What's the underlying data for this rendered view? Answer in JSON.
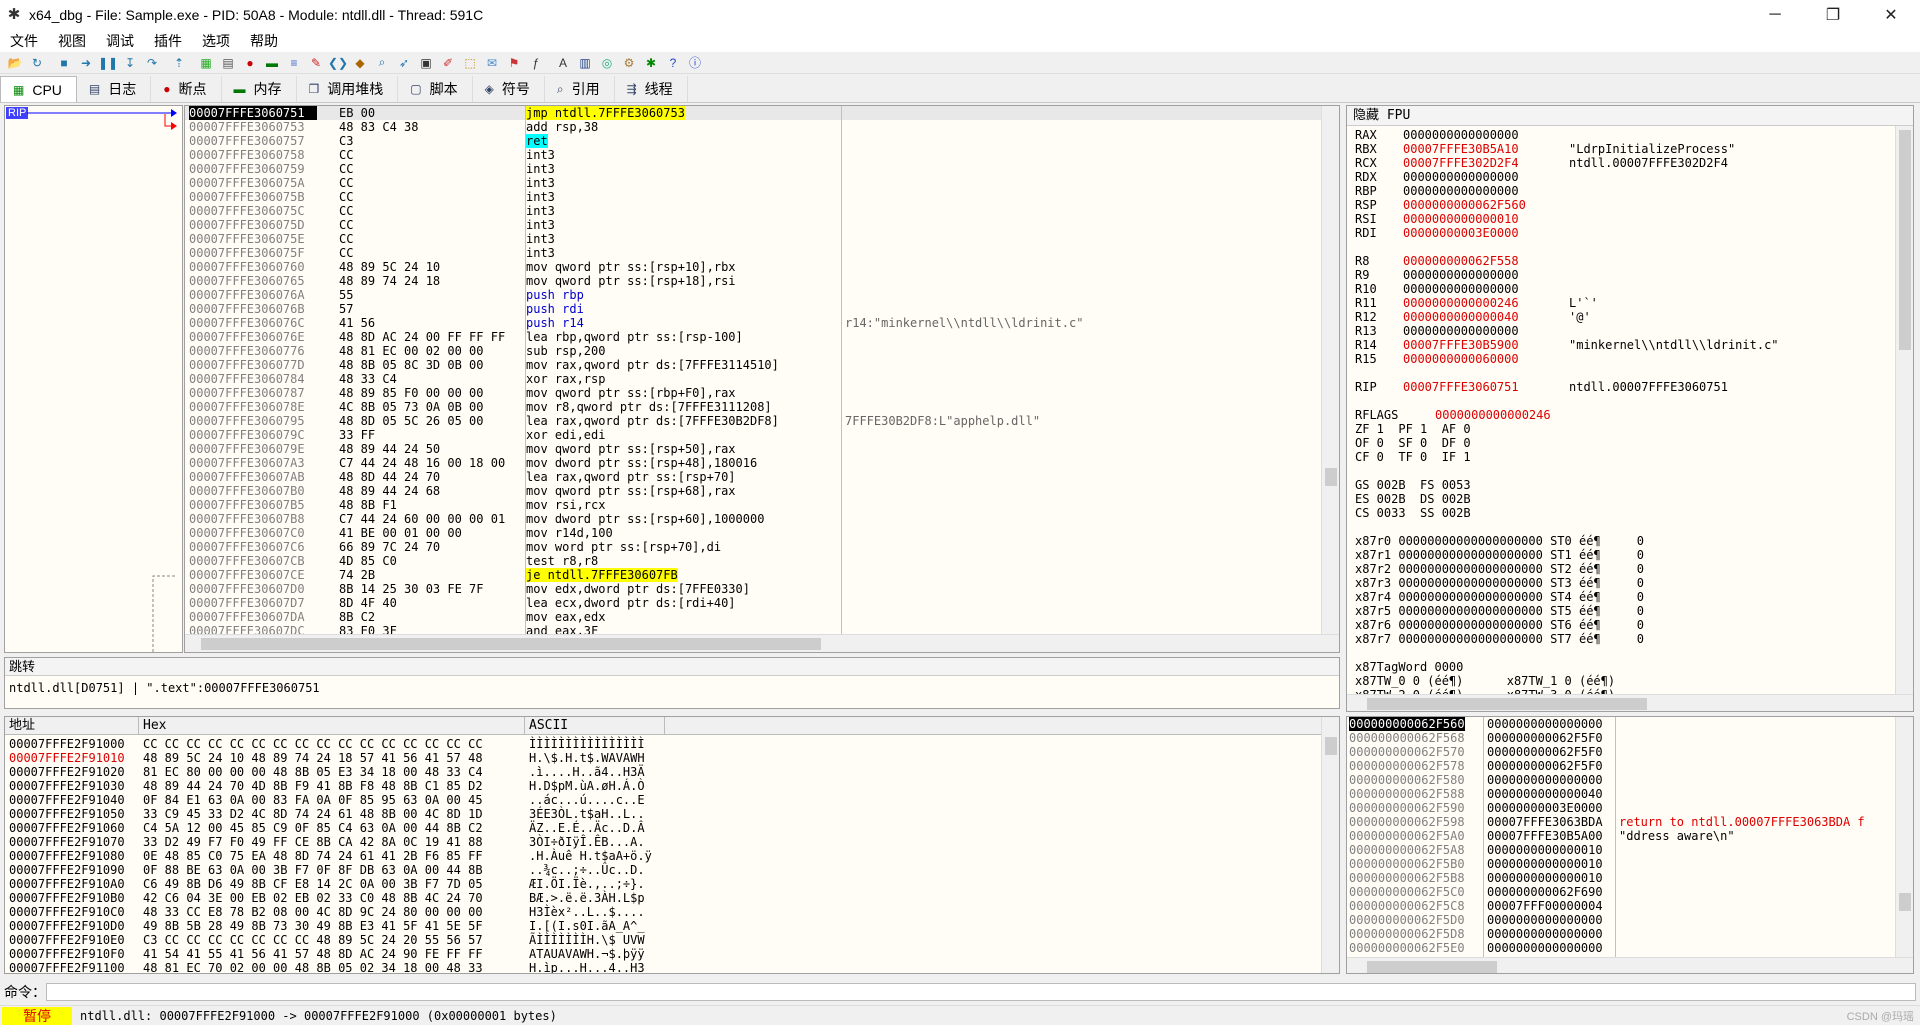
{
  "window": {
    "title": "x64_dbg - File: Sample.exe - PID: 50A8 - Module: ntdll.dll - Thread: 591C",
    "min": "─",
    "max": "❐",
    "close": "✕"
  },
  "menu": [
    "文件",
    "视图",
    "调试",
    "插件",
    "选项",
    "帮助"
  ],
  "toolbar_icons": [
    "open-icon",
    "restart-icon",
    "stop-icon",
    "run-icon",
    "pause-icon",
    "step-into-icon",
    "step-over-icon",
    "execute-till-return-icon",
    "cpu-icon",
    "log-icon",
    "breakpoint-icon",
    "memory-icon",
    "callstack-icon",
    "patch-icon",
    "script-icon",
    "symbol-icon",
    "find-icon",
    "trace-icon",
    "options-icon",
    "pattern-icon",
    "label-icon",
    "comment-icon",
    "bookmark-icon",
    "function-icon",
    "font-icon",
    "calculator-icon",
    "notes-icon",
    "settings-icon",
    "plugin-icon",
    "help-icon",
    "about-icon"
  ],
  "tabs": [
    {
      "label": "CPU",
      "icon": "cpu-icon"
    },
    {
      "label": "日志",
      "icon": "log-icon"
    },
    {
      "label": "断点",
      "icon": "breakpoint-icon"
    },
    {
      "label": "内存",
      "icon": "memory-icon"
    },
    {
      "label": "调用堆栈",
      "icon": "callstack-icon"
    },
    {
      "label": "脚本",
      "icon": "script-icon"
    },
    {
      "label": "符号",
      "icon": "symbol-icon"
    },
    {
      "label": "引用",
      "icon": "reference-icon"
    },
    {
      "label": "线程",
      "icon": "thread-icon"
    }
  ],
  "rip_label": "RIP",
  "disasm": [
    {
      "a": "00007FFFE3060751",
      "b": "EB 00",
      "i": "jmp ntdll.7FFFE3060753",
      "c": "",
      "k": "jmp",
      "cur": true
    },
    {
      "a": "00007FFFE3060753",
      "b": "48 83 C4 38",
      "i": "add rsp,38",
      "c": ""
    },
    {
      "a": "00007FFFE3060757",
      "b": "C3",
      "i": "ret",
      "c": "",
      "k": "ret"
    },
    {
      "a": "00007FFFE3060758",
      "b": "CC",
      "i": "int3",
      "c": ""
    },
    {
      "a": "00007FFFE3060759",
      "b": "CC",
      "i": "int3",
      "c": ""
    },
    {
      "a": "00007FFFE306075A",
      "b": "CC",
      "i": "int3",
      "c": ""
    },
    {
      "a": "00007FFFE306075B",
      "b": "CC",
      "i": "int3",
      "c": ""
    },
    {
      "a": "00007FFFE306075C",
      "b": "CC",
      "i": "int3",
      "c": ""
    },
    {
      "a": "00007FFFE306075D",
      "b": "CC",
      "i": "int3",
      "c": ""
    },
    {
      "a": "00007FFFE306075E",
      "b": "CC",
      "i": "int3",
      "c": ""
    },
    {
      "a": "00007FFFE306075F",
      "b": "CC",
      "i": "int3",
      "c": ""
    },
    {
      "a": "00007FFFE3060760",
      "b": "48 89 5C 24 10",
      "i": "mov qword ptr ss:[rsp+10],rbx",
      "c": ""
    },
    {
      "a": "00007FFFE3060765",
      "b": "48 89 74 24 18",
      "i": "mov qword ptr ss:[rsp+18],rsi",
      "c": ""
    },
    {
      "a": "00007FFFE306076A",
      "b": "55",
      "i": "push rbp",
      "c": ""
    },
    {
      "a": "00007FFFE306076B",
      "b": "57",
      "i": "push rdi",
      "c": ""
    },
    {
      "a": "00007FFFE306076C",
      "b": "41 56",
      "i": "push r14",
      "c": "r14:\"minkernel\\\\ntdll\\\\ldrinit.c\""
    },
    {
      "a": "00007FFFE306076E",
      "b": "48 8D AC 24 00 FF FF FF",
      "i": "lea rbp,qword ptr ss:[rsp-100]",
      "c": ""
    },
    {
      "a": "00007FFFE3060776",
      "b": "48 81 EC 00 02 00 00",
      "i": "sub rsp,200",
      "c": ""
    },
    {
      "a": "00007FFFE306077D",
      "b": "48 8B 05 8C 3D 0B 00",
      "i": "mov rax,qword ptr ds:[7FFFE3114510]",
      "c": ""
    },
    {
      "a": "00007FFFE3060784",
      "b": "48 33 C4",
      "i": "xor rax,rsp",
      "c": ""
    },
    {
      "a": "00007FFFE3060787",
      "b": "48 89 85 F0 00 00 00",
      "i": "mov qword ptr ss:[rbp+F0],rax",
      "c": ""
    },
    {
      "a": "00007FFFE306078E",
      "b": "4C 8B 05 73 0A 0B 00",
      "i": "mov r8,qword ptr ds:[7FFFE3111208]",
      "c": ""
    },
    {
      "a": "00007FFFE3060795",
      "b": "48 8D 05 5C 26 05 00",
      "i": "lea rax,qword ptr ds:[7FFFE30B2DF8]",
      "c": "7FFFE30B2DF8:L\"apphelp.dll\""
    },
    {
      "a": "00007FFFE306079C",
      "b": "33 FF",
      "i": "xor edi,edi",
      "c": ""
    },
    {
      "a": "00007FFFE306079E",
      "b": "48 89 44 24 50",
      "i": "mov qword ptr ss:[rsp+50],rax",
      "c": ""
    },
    {
      "a": "00007FFFE30607A3",
      "b": "C7 44 24 48 16 00 18 00",
      "i": "mov dword ptr ss:[rsp+48],180016",
      "c": ""
    },
    {
      "a": "00007FFFE30607AB",
      "b": "48 8D 44 24 70",
      "i": "lea rax,qword ptr ss:[rsp+70]",
      "c": ""
    },
    {
      "a": "00007FFFE30607B0",
      "b": "48 89 44 24 68",
      "i": "mov qword ptr ss:[rsp+68],rax",
      "c": ""
    },
    {
      "a": "00007FFFE30607B5",
      "b": "48 8B F1",
      "i": "mov rsi,rcx",
      "c": ""
    },
    {
      "a": "00007FFFE30607B8",
      "b": "C7 44 24 60 00 00 00 01",
      "i": "mov dword ptr ss:[rsp+60],1000000",
      "c": ""
    },
    {
      "a": "00007FFFE30607C0",
      "b": "41 BE 00 01 00 00",
      "i": "mov r14d,100",
      "c": ""
    },
    {
      "a": "00007FFFE30607C6",
      "b": "66 89 7C 24 70",
      "i": "mov word ptr ss:[rsp+70],di",
      "c": ""
    },
    {
      "a": "00007FFFE30607CB",
      "b": "4D 85 C0",
      "i": "test r8,r8",
      "c": ""
    },
    {
      "a": "00007FFFE30607CE",
      "b": "74 2B",
      "i": "je ntdll.7FFFE30607FB",
      "c": "",
      "k": "je"
    },
    {
      "a": "00007FFFE30607D0",
      "b": "8B 14 25 30 03 FE 7F",
      "i": "mov edx,dword ptr ds:[7FFE0330]",
      "c": ""
    },
    {
      "a": "00007FFFE30607D7",
      "b": "8D 4F 40",
      "i": "lea ecx,dword ptr ds:[rdi+40]",
      "c": ""
    },
    {
      "a": "00007FFFE30607DA",
      "b": "8B C2",
      "i": "mov eax,edx",
      "c": ""
    },
    {
      "a": "00007FFFE30607DC",
      "b": "83 E0 3F",
      "i": "and eax,3F",
      "c": ""
    }
  ],
  "registers": {
    "header": "隐藏 FPU",
    "gp": [
      {
        "n": "RAX",
        "v": "0000000000000000",
        "c": "",
        "red": false
      },
      {
        "n": "RBX",
        "v": "00007FFFE30B5A10",
        "c": "\"LdrpInitializeProcess\"",
        "red": true
      },
      {
        "n": "RCX",
        "v": "00007FFFE302D2F4",
        "c": "ntdll.00007FFFE302D2F4",
        "red": true
      },
      {
        "n": "RDX",
        "v": "0000000000000000",
        "c": "",
        "red": false
      },
      {
        "n": "RBP",
        "v": "0000000000000000",
        "c": "",
        "red": false
      },
      {
        "n": "RSP",
        "v": "0000000000062F560",
        "c": "",
        "red": true
      },
      {
        "n": "RSI",
        "v": "0000000000000010",
        "c": "",
        "red": true
      },
      {
        "n": "RDI",
        "v": "00000000003E0000",
        "c": "",
        "red": true
      },
      {
        "n": "",
        "v": "",
        "c": "",
        "red": false
      },
      {
        "n": "R8",
        "v": "000000000062F558",
        "c": "",
        "red": true
      },
      {
        "n": "R9",
        "v": "0000000000000000",
        "c": "",
        "red": false
      },
      {
        "n": "R10",
        "v": "0000000000000000",
        "c": "",
        "red": false
      },
      {
        "n": "R11",
        "v": "0000000000000246",
        "c": "L'`'",
        "red": true
      },
      {
        "n": "R12",
        "v": "0000000000000040",
        "c": "'@'",
        "red": true
      },
      {
        "n": "R13",
        "v": "0000000000000000",
        "c": "",
        "red": false
      },
      {
        "n": "R14",
        "v": "00007FFFE30B5900",
        "c": "\"minkernel\\\\ntdll\\\\ldrinit.c\"",
        "red": true
      },
      {
        "n": "R15",
        "v": "0000000000060000",
        "c": "",
        "red": true
      },
      {
        "n": "",
        "v": "",
        "c": "",
        "red": false
      },
      {
        "n": "RIP",
        "v": "00007FFFE3060751",
        "c": "ntdll.00007FFFE3060751",
        "red": true
      },
      {
        "n": "",
        "v": "",
        "c": "",
        "red": false
      },
      {
        "n": "RFLAGS",
        "v": "0000000000000246",
        "c": "",
        "red": true
      }
    ],
    "flags": [
      "ZF 1  PF 1  AF 0",
      "OF 0  SF 0  DF 0",
      "CF 0  TF 0  IF 1"
    ],
    "segs": [
      "GS 002B  FS 0053",
      "ES 002B  DS 002B",
      "CS 0033  SS 002B"
    ],
    "x87": [
      "x87r0 00000000000000000000 ST0 éé¶     0",
      "x87r1 00000000000000000000 ST1 éé¶     0",
      "x87r2 00000000000000000000 ST2 éé¶     0",
      "x87r3 00000000000000000000 ST3 éé¶     0",
      "x87r4 00000000000000000000 ST4 éé¶     0",
      "x87r5 00000000000000000000 ST5 éé¶     0",
      "x87r6 00000000000000000000 ST6 éé¶     0",
      "x87r7 00000000000000000000 ST7 éé¶     0"
    ],
    "tagword": "x87TagWord 0000",
    "tw0": "x87TW_0 0 (éé¶)      x87TW_1 0 (éé¶)",
    "tw2": "x87TW_2 0 (éé¶)      x87TW_3 0 (éé¶)"
  },
  "jump": {
    "header": "跳转",
    "text": "ntdll.dll[D0751] | \".text\":00007FFFE3060751"
  },
  "dump": {
    "headers": [
      "地址",
      "Hex",
      "ASCII"
    ],
    "rows": [
      {
        "a": "00007FFFE2F91000",
        "h": "CC CC CC CC CC CC CC CC CC CC CC CC CC CC CC CC",
        "s": "ÌÌÌÌÌÌÌÌÌÌÌÌÌÌÌÌ"
      },
      {
        "a": "00007FFFE2F91010",
        "h": "48 89 5C 24 10 48 89 74 24 18 57 41 56 41 57 48",
        "s": "H.\\$.H.t$.WAVAWH",
        "red": true
      },
      {
        "a": "00007FFFE2F91020",
        "h": "81 EC 80 00 00 00 48 8B 05 E3 34 18 00 48 33 C4",
        "s": ".ì....H..ã4..H3Ä"
      },
      {
        "a": "00007FFFE2F91030",
        "h": "48 89 44 24 70 4D 8B F9 41 8B F8 48 8B C1 85 D2",
        "s": "H.D$pM.ùA.øH.Á.Ò"
      },
      {
        "a": "00007FFFE2F91040",
        "h": "0F 84 E1 63 0A 00 83 FA 0A 0F 85 95 63 0A 00 45",
        "s": "..ác...ú....c..E"
      },
      {
        "a": "00007FFFE2F91050",
        "h": "33 C9 45 33 D2 4C 8D 74 24 61 48 8B 00 4C 8D 1D",
        "s": "3ÉE3ÒL.t$aH..L.."
      },
      {
        "a": "00007FFFE2F91060",
        "h": "C4 5A 12 00 45 85 C9 0F 85 C4 63 0A 00 44 8B C2",
        "s": "ÄZ..E.É..Äc..D.Â"
      },
      {
        "a": "00007FFFE2F91070",
        "h": "33 D2 49 F7 F0 49 FF CE 8B CA 42 8A 0C 19 41 88",
        "s": "3ÒI÷ðIÿÎ.ÊB...A."
      },
      {
        "a": "00007FFFE2F91080",
        "h": "0E 48 85 C0 75 EA 48 8D 74 24 61 41 2B F6 85 FF",
        "s": ".H.Àuê H.t$aA+ö.ÿ"
      },
      {
        "a": "00007FFFE2F91090",
        "h": "0F 88 BE 63 0A 00 3B F7 0F 8F DB 63 0A 00 44 8B",
        "s": "..¾c..;÷..Ûc..D."
      },
      {
        "a": "00007FFFE2F910A0",
        "h": "C6 49 8B D6 49 8B CF E8 14 2C 0A 00 3B F7 7D 05",
        "s": "ÆI.ÖI.Ïè.,..;÷}."
      },
      {
        "a": "00007FFFE2F910B0",
        "h": "42 C6 04 3E 00 EB 02 EB 02 33 C0 48 8B 4C 24 70",
        "s": "BÆ.>.ë.ë.3ÀH.L$p"
      },
      {
        "a": "00007FFFE2F910C0",
        "h": "48 33 CC E8 78 B2 08 00 4C 8D 9C 24 80 00 00 00",
        "s": "H3Ìèx²..L..$...."
      },
      {
        "a": "00007FFFE2F910D0",
        "h": "49 8B 5B 28 49 8B 73 30 49 8B E3 41 5F 41 5E 5F",
        "s": "I.[(I.s0I.ãA_A^_"
      },
      {
        "a": "00007FFFE2F910E0",
        "h": "C3 CC CC CC CC CC CC CC 48 89 5C 24 20 55 56 57",
        "s": "ÃÌÌÌÌÌÌÌH.\\$ UVW"
      },
      {
        "a": "00007FFFE2F910F0",
        "h": "41 54 41 55 41 56 41 57 48 8D AC 24 90 FE FF FF",
        "s": "ATAUAVAWH.¬$.þÿÿ"
      },
      {
        "a": "00007FFFE2F91100",
        "h": "48 81 EC 70 02 00 00 48 8B 05 02 34 18 00 48 33",
        "s": "H.ìp...H...4..H3"
      }
    ]
  },
  "stack": [
    {
      "a": "000000000062F560",
      "v": "0000000000000000",
      "c": "",
      "cur": true
    },
    {
      "a": "000000000062F568",
      "v": "000000000062F5F0",
      "c": ""
    },
    {
      "a": "000000000062F570",
      "v": "000000000062F5F0",
      "c": ""
    },
    {
      "a": "000000000062F578",
      "v": "000000000062F5F0",
      "c": ""
    },
    {
      "a": "000000000062F580",
      "v": "0000000000000000",
      "c": ""
    },
    {
      "a": "000000000062F588",
      "v": "0000000000000040",
      "c": ""
    },
    {
      "a": "000000000062F590",
      "v": "00000000003E0000",
      "c": ""
    },
    {
      "a": "000000000062F598",
      "v": "00007FFFE3063BDA",
      "c": "return to ntdll.00007FFFE3063BDA f",
      "red": true
    },
    {
      "a": "000000000062F5A0",
      "v": "00007FFFE30B5A00",
      "c": "\"ddress aware\\n\""
    },
    {
      "a": "000000000062F5A8",
      "v": "0000000000000010",
      "c": ""
    },
    {
      "a": "000000000062F5B0",
      "v": "0000000000000010",
      "c": ""
    },
    {
      "a": "000000000062F5B8",
      "v": "0000000000000010",
      "c": ""
    },
    {
      "a": "000000000062F5C0",
      "v": "000000000062F690",
      "c": ""
    },
    {
      "a": "000000000062F5C8",
      "v": "00007FFF00000004",
      "c": ""
    },
    {
      "a": "000000000062F5D0",
      "v": "0000000000000000",
      "c": ""
    },
    {
      "a": "000000000062F5D8",
      "v": "0000000000000000",
      "c": ""
    },
    {
      "a": "000000000062F5E0",
      "v": "0000000000000000",
      "c": ""
    }
  ],
  "cmd_label": "命令：",
  "status": {
    "state": "暂停",
    "message": "ntdll.dll: 00007FFFE2F91000 -> 00007FFFE2F91000 (0x00000001 bytes)",
    "watermark": "CSDN @玛瑶"
  }
}
